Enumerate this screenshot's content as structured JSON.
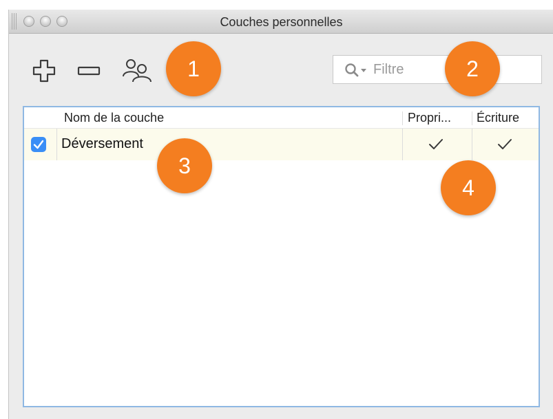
{
  "window": {
    "title": "Couches personnelles"
  },
  "toolbar": {
    "add_icon": "plus-icon",
    "remove_icon": "minus-icon",
    "users_icon": "users-icon"
  },
  "filter": {
    "placeholder": "Filtre",
    "icon": "search-icon"
  },
  "callouts": [
    "1",
    "2",
    "3",
    "4"
  ],
  "colors": {
    "callout": "#f47e20",
    "checkbox": "#3a8ef6",
    "table_border": "#8fb8e3",
    "row_highlight": "#fcfbec"
  },
  "table": {
    "columns": [
      "Nom de la couche",
      "Propri...",
      "Écriture"
    ],
    "rows": [
      {
        "checked": true,
        "name": "Déversement",
        "owner": true,
        "write": true
      }
    ]
  }
}
